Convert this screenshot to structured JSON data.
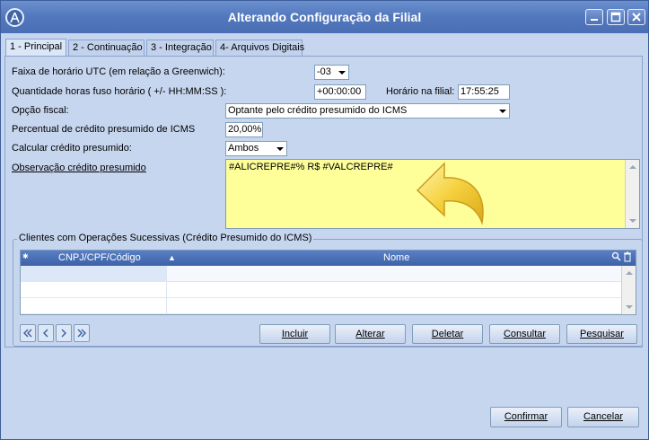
{
  "window": {
    "title": "Alterando Configuração da Filial"
  },
  "tabs": [
    {
      "label": "1 - Principal",
      "active": true
    },
    {
      "label": "2 - Continuação",
      "active": false
    },
    {
      "label": "3 - Integração",
      "active": false
    },
    {
      "label": "4- Arquivos Digitais",
      "active": false
    }
  ],
  "form": {
    "utc_label": "Faixa de horário UTC (em relação a Greenwich):",
    "utc_value": "-03",
    "fuso_label": "Quantidade horas fuso horário ( +/- HH:MM:SS ):",
    "fuso_value": "+00:00:00",
    "horario_label": "Horário na filial:",
    "horario_value": "17:55:25",
    "opcao_label": "Opção fiscal:",
    "opcao_value": "Optante pelo crédito presumido do ICMS",
    "percentual_label": "Percentual de crédito presumido de ICMS",
    "percentual_value": "20,00%",
    "calcular_label": "Calcular crédito presumido:",
    "calcular_value": "Ambos",
    "observacao_label": "Observação crédito presumido",
    "observacao_value": "#ALICREPRE#% R$ #VALCREPRE#"
  },
  "clientes": {
    "title": "Clientes com Operações Sucessivas (Crédito Presumido do ICMS)",
    "columns": [
      "CNPJ/CPF/Código",
      "Nome"
    ],
    "rows": [
      [
        "",
        ""
      ],
      [
        "",
        ""
      ],
      [
        "",
        ""
      ]
    ]
  },
  "buttons": {
    "incluir": "Incluir",
    "alterar": "Alterar",
    "deletar": "Deletar",
    "consultar": "Consultar",
    "pesquisar": "Pesquisar",
    "confirmar": "Confirmar",
    "cancelar": "Cancelar"
  },
  "icons": {
    "app": "app-logo-icon",
    "minimize": "minimize-icon",
    "maximize": "maximize-icon",
    "close": "close-icon",
    "first": "first-record-icon",
    "prev": "previous-record-icon",
    "next": "next-record-icon",
    "last": "last-record-icon",
    "hint_arrow": "curved-arrow-icon"
  },
  "colors": {
    "title_bar": "#5277bd",
    "memo_bg": "#ffff99",
    "grid_header": "#4a6fb4",
    "window_bg": "#c7d6ef"
  }
}
